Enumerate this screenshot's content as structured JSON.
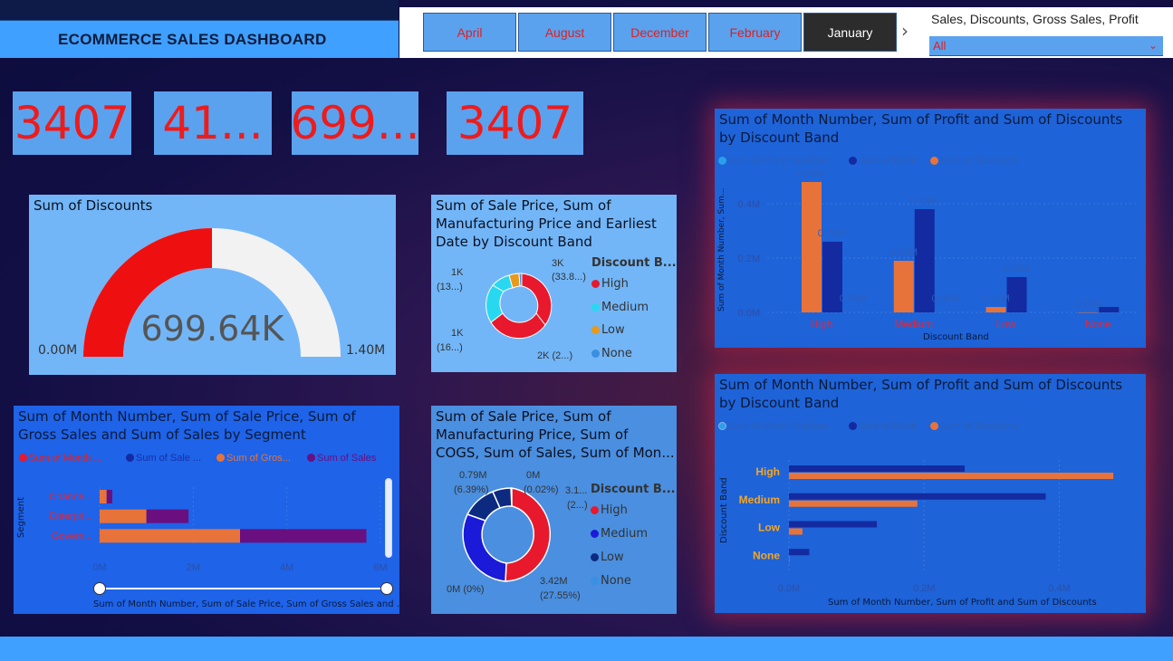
{
  "header": {
    "title": "ECOMMERCE SALES DASHBOARD"
  },
  "months": [
    "April",
    "August",
    "December",
    "February",
    "January"
  ],
  "months_selected": "January",
  "filter": {
    "label": "Sales, Discounts, Gross Sales, Profit",
    "value": "All"
  },
  "kpis": [
    "3407",
    "41...",
    "699...",
    "3407"
  ],
  "gauge": {
    "title": "Sum of Discounts",
    "value_label": "699.64K",
    "min_label": "0.00M",
    "max_label": "1.40M",
    "fraction": 0.5
  },
  "donut1": {
    "title_lines": [
      "Sum of Sale Price, Sum of",
      "Manufacturing Price and Earliest",
      "Date by Discount Band"
    ],
    "legend_title": "Discount B...",
    "legend": [
      "High",
      "Medium",
      "Low",
      "None"
    ],
    "labels": {
      "a1": "3K",
      "a2": "(33.8...)",
      "b1": "1K",
      "b2": "(13...)",
      "c1": "1K",
      "c2": "(16...)",
      "d1": "2K (2...)"
    }
  },
  "donut2": {
    "title_lines": [
      "Sum of Sale Price, Sum of",
      "Manufacturing Price, Sum of",
      "COGS, Sum of Sales, Sum of Mon..."
    ],
    "legend_title": "Discount B...",
    "legend": [
      "High",
      "Medium",
      "Low",
      "None"
    ],
    "labels": {
      "a1": "0.79M",
      "a2": "(6.39%)",
      "b1": "0M",
      "b2": "(0.02%)",
      "c1": "3.1...",
      "c2": "(2...)",
      "d1": "0M (0%)",
      "e1": "3.42M",
      "e2": "(27.55%)"
    }
  },
  "colors": {
    "high": "#e8192c",
    "medium": "#28d8f0",
    "low": "#e89a1a",
    "none": "#3a8fe0",
    "navy": "#142aa0",
    "orange": "#e8733a",
    "purple": "#6a0f80",
    "blue2": "#1a1ad8",
    "navy2": "#0c2a80"
  },
  "chart_data": [
    {
      "type": "bar",
      "title": "Sum of Month Number, Sum of Profit and Sum of Discounts by Discount Band",
      "xlabel": "Discount Band",
      "ylabel": "Sum of Month Number, Sum...",
      "categories": [
        "High",
        "Medium",
        "Low",
        "None"
      ],
      "series": [
        {
          "name": "Sum of Month Number",
          "values": [
            0,
            0,
            0,
            0
          ]
        },
        {
          "name": "Sum of Profit",
          "values": [
            0.26,
            0.38,
            0.13,
            0.02
          ]
        },
        {
          "name": "Sum of Discounts",
          "values": [
            0.48,
            0.19,
            0.02,
            0.0
          ]
        }
      ],
      "data_labels": [
        [
          "0.48M",
          "0.26M",
          "0.00M"
        ],
        [
          "0.38M",
          "0.19M",
          "0.00M"
        ],
        [
          "0.14M",
          "0.00M"
        ],
        [
          "0.00M"
        ]
      ],
      "yticks": [
        "0.0M",
        "0.2M",
        "0.4M"
      ],
      "ylim": [
        0,
        0.5
      ]
    },
    {
      "type": "bar",
      "orientation": "horizontal",
      "title": "Sum of Month Number, Sum of Profit and Sum of Discounts by Discount Band",
      "xlabel": "Sum of Month Number, Sum of Profit and Sum of Discounts",
      "ylabel": "Discount Band",
      "categories": [
        "High",
        "Medium",
        "Low",
        "None"
      ],
      "series": [
        {
          "name": "Sum of Month Number",
          "values": [
            0,
            0,
            0,
            0
          ]
        },
        {
          "name": "Sum of Profit",
          "values": [
            0.26,
            0.38,
            0.13,
            0.03
          ]
        },
        {
          "name": "Sum of Discounts",
          "values": [
            0.48,
            0.19,
            0.02,
            0.0
          ]
        }
      ],
      "xticks": [
        "0.0M",
        "0.2M",
        "0.4M"
      ],
      "xlim": [
        0,
        0.5
      ]
    },
    {
      "type": "bar",
      "orientation": "horizontal",
      "stacked": true,
      "title": "Sum of Month Number, Sum of Sale Price, Sum of Gross Sales and Sum of Sales by Segment",
      "xlabel": "Sum of Month Number, Sum of Sale Price, Sum of Gross Sales and ...",
      "ylabel": "Segment",
      "categories": [
        "Channe...",
        "Enterpri...",
        "Govern..."
      ],
      "series": [
        {
          "name": "Sum of Month ...",
          "values": [
            0,
            0,
            0
          ]
        },
        {
          "name": "Sum of Sale ...",
          "values": [
            0,
            0,
            0
          ]
        },
        {
          "name": "Sum of Gros...",
          "values": [
            0.15,
            1.0,
            3.0
          ]
        },
        {
          "name": "Sum of Sales",
          "values": [
            0.12,
            0.9,
            2.7
          ]
        }
      ],
      "xticks": [
        "0M",
        "2M",
        "4M",
        "6M"
      ],
      "xlim": [
        0,
        6
      ]
    }
  ]
}
